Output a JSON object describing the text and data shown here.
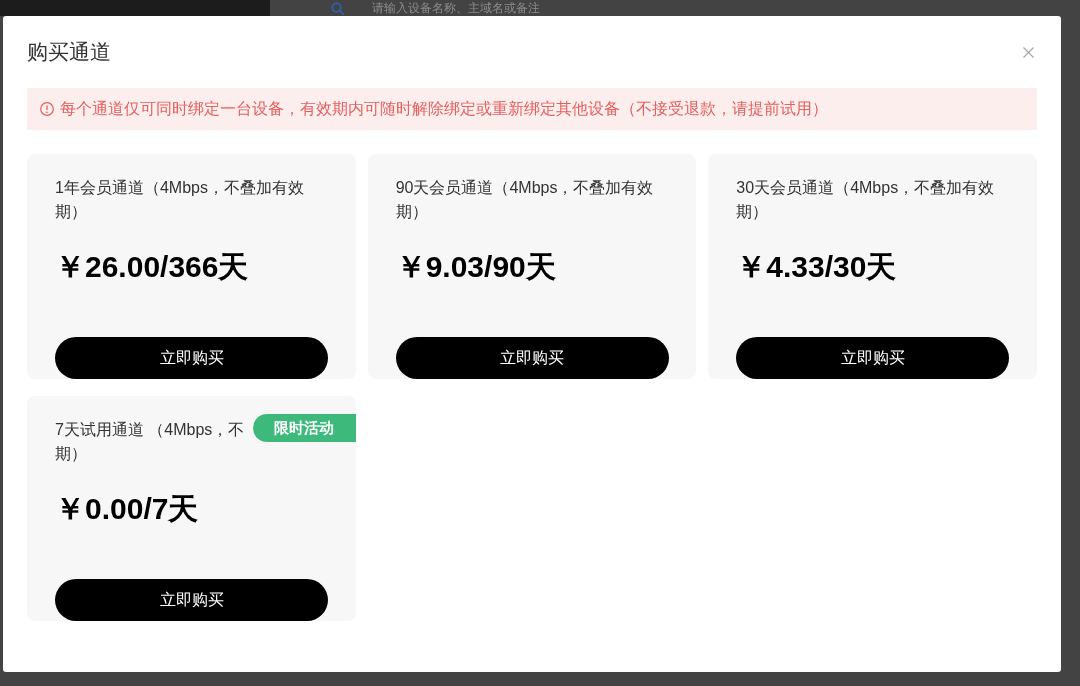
{
  "background": {
    "search": {
      "placeholder": "请输入设备名称、主域名或备注"
    }
  },
  "dialog": {
    "title": "购买通道",
    "notice": "每个通道仅可同时绑定一台设备，有效期内可随时解除绑定或重新绑定其他设备（不接受退款，请提前试用）",
    "plans": [
      {
        "description": "1年会员通道（4Mbps，不叠加有效期）",
        "price": "￥26.00/366天",
        "button": "立即购买"
      },
      {
        "description": "90天会员通道（4Mbps，不叠加有效期）",
        "price": "￥9.03/90天",
        "button": "立即购买"
      },
      {
        "description": "30天会员通道（4Mbps，不叠加有效期）",
        "price": "￥4.33/30天",
        "button": "立即购买"
      },
      {
        "description": "7天试用通道 （4Mbps，不",
        "description_end": "期）",
        "price": "￥0.00/7天",
        "button": "立即购买",
        "badge": "限时活动"
      }
    ]
  }
}
